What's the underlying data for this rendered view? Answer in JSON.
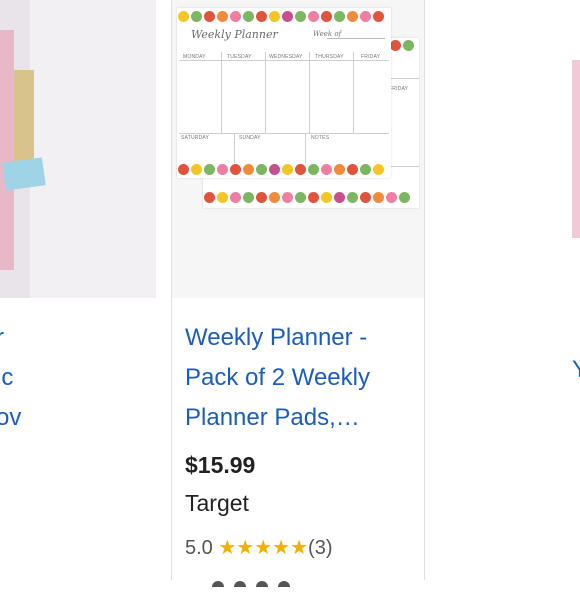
{
  "left_card": {
    "title_lines": [
      "r",
      "ic",
      "ov"
    ]
  },
  "right_card": {
    "title_lines": [
      "Y"
    ]
  },
  "product": {
    "image_alt": "Weekly Planner pads with floral border",
    "pad_text": {
      "heading": "Weekly Planner",
      "week_of": "Week of",
      "days_top": [
        "MONDAY",
        "TUESDAY",
        "WEDNESDAY",
        "THURSDAY",
        "FRIDAY"
      ],
      "days_bottom": [
        "SATURDAY",
        "SUNDAY",
        "NOTES"
      ],
      "back_pad_day": "FRIDAY"
    },
    "title_lines": [
      "Weekly Planner -",
      "Pack of 2 Weekly",
      "Planner Pads,…"
    ],
    "price": "$15.99",
    "store": "Target",
    "rating_value": "5.0",
    "rating_stars": "★★★★★",
    "rating_count": "(3)",
    "rating_fraction": 1.0
  },
  "colors": {
    "link_blue": "#1a5dbf",
    "star_gold": "#f2b000",
    "image_bg": "#f6f6f7"
  }
}
